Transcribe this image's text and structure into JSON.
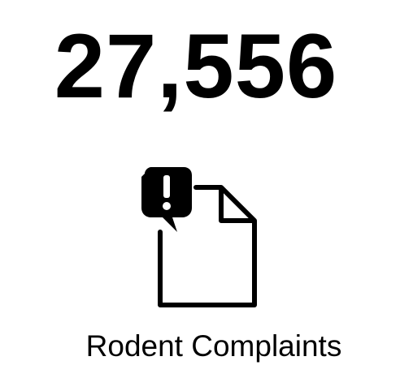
{
  "stat": {
    "value": "27,556",
    "label": "Rodent Complaints",
    "icon": "document-alert-icon"
  },
  "colors": {
    "text": "#000000",
    "background": "#ffffff"
  }
}
